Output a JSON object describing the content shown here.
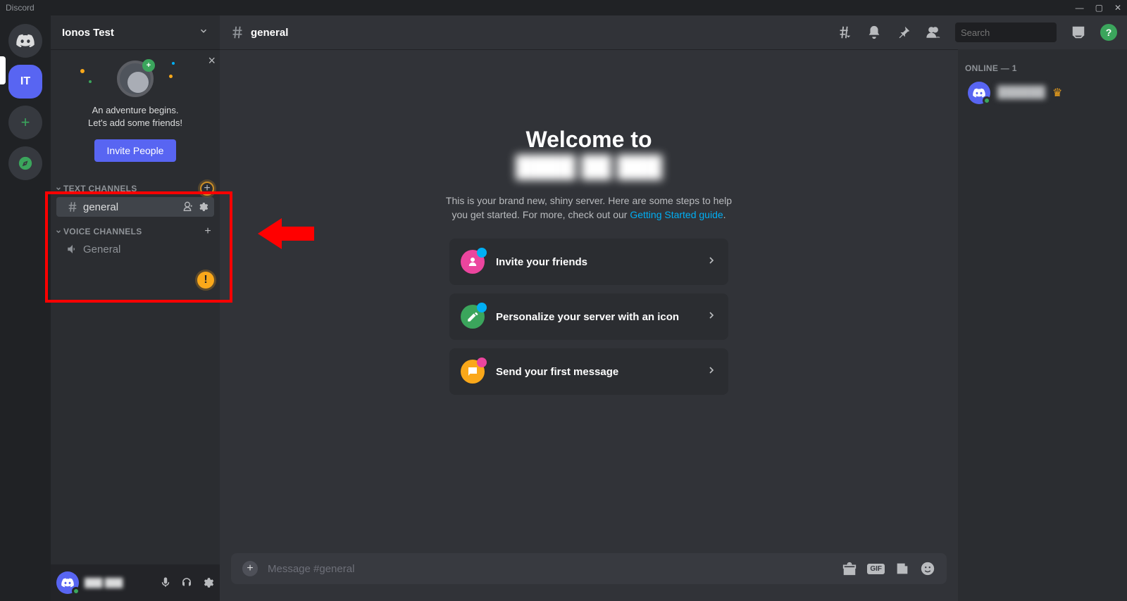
{
  "titlebar": {
    "app_name": "Discord",
    "min": "—",
    "max": "▢",
    "close": "✕"
  },
  "guilds": {
    "home": "⌂",
    "server_initials": "IT",
    "add": "+",
    "explore": "✦"
  },
  "server_header": {
    "name": "Ionos Test"
  },
  "invite": {
    "line1": "An adventure begins.",
    "line2": "Let's add some friends!",
    "button": "Invite People"
  },
  "channel_groups": {
    "text_label": "TEXT CHANNELS",
    "voice_label": "VOICE CHANNELS",
    "text": [
      {
        "name": "general",
        "active": true
      }
    ],
    "voice": [
      {
        "name": "General"
      }
    ]
  },
  "channel_header": {
    "name": "general"
  },
  "search": {
    "placeholder": "Search"
  },
  "welcome": {
    "title": "Welcome to",
    "server_name": "████ ██ ███",
    "desc1": "This is your brand new, shiny server. Here are some steps to help",
    "desc2": "you get started. For more, check out our ",
    "link": "Getting Started guide",
    "cards": {
      "invite": "Invite your friends",
      "personalize": "Personalize your server with an icon",
      "first_message": "Send your first message"
    }
  },
  "compose": {
    "placeholder": "Message #general"
  },
  "members": {
    "header": "ONLINE — 1",
    "user1": "██████"
  },
  "user_panel": {
    "name": "███ ███"
  },
  "help": {
    "glyph": "?"
  },
  "icons": {
    "hash": "#",
    "gif": "GIF"
  },
  "badges": {
    "exclaim": "!"
  }
}
